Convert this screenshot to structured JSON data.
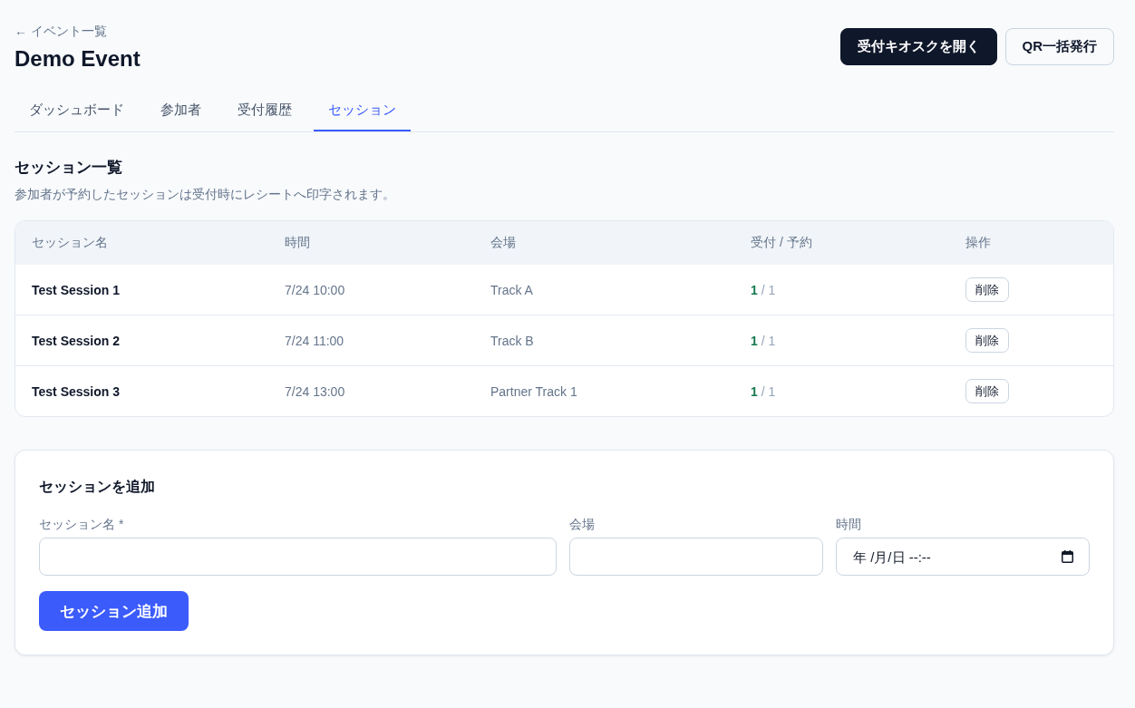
{
  "header": {
    "back_link": "← イベント一覧",
    "title": "Demo Event",
    "actions": [
      {
        "label": "受付キオスクを開く",
        "kind": "primary"
      },
      {
        "label": "QR一括発行",
        "kind": "secondary"
      }
    ]
  },
  "tabs": [
    {
      "label": "ダッシュボード",
      "selected": false
    },
    {
      "label": "参加者",
      "selected": false
    },
    {
      "label": "受付履歴",
      "selected": false
    },
    {
      "label": "セッション",
      "selected": true
    }
  ],
  "sessions_section": {
    "title": "セッション一覧",
    "description": "参加者が予約したセッションは受付時にレシートへ印字されます。",
    "table": {
      "columns": [
        "セッション名",
        "時間",
        "会場",
        "受付 / 予約",
        "操作"
      ],
      "rows": [
        {
          "name": "Test Session 1",
          "time": "7/24 10:00",
          "venue": "Track A",
          "count": "**1** / 1",
          "action": "削除"
        },
        {
          "name": "Test Session 2",
          "time": "7/24 11:00",
          "venue": "Track B",
          "count": "**1** / 1",
          "action": "削除"
        },
        {
          "name": "Test Session 3",
          "time": "7/24 13:00",
          "venue": "Partner Track 1",
          "count": "**1** / 1",
          "action": "削除"
        }
      ]
    }
  },
  "add_form": {
    "title": "セッションを追加",
    "fields": [
      {
        "label": "セッション名 *",
        "kind": "text"
      },
      {
        "label": "会場",
        "kind": "text"
      },
      {
        "label": "時間",
        "kind": "datetime",
        "placeholder": "年 /月/日 --:--"
      }
    ],
    "submit": "セッション追加"
  }
}
